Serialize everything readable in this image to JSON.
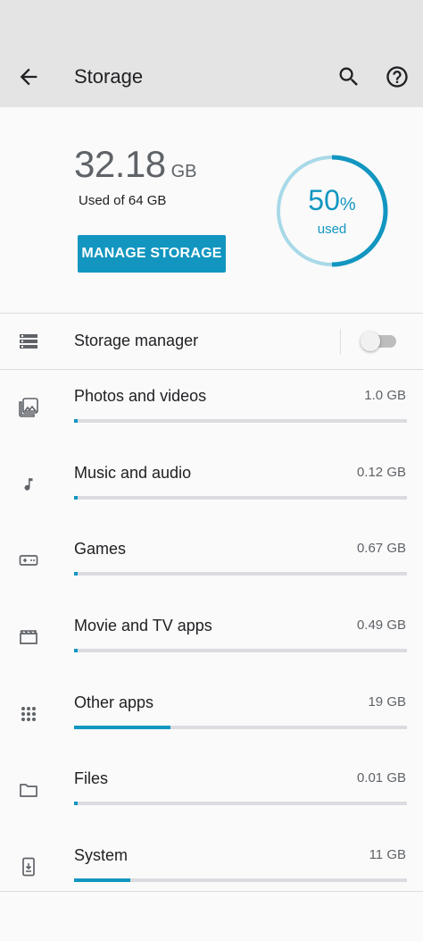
{
  "app_bar": {
    "title": "Storage",
    "back_icon": "arrow-back-icon",
    "search_icon": "search-icon",
    "help_icon": "help-icon"
  },
  "summary": {
    "used_number": "32.18",
    "used_unit": "GB",
    "used_of": "Used of 64 GB",
    "manage_button": "MANAGE STORAGE",
    "percent": "50",
    "percent_sign": "%",
    "used_word": "used",
    "percent_fraction": 0.5
  },
  "storage_manager": {
    "label": "Storage manager",
    "icon": "storage-icon",
    "enabled": false
  },
  "colors": {
    "accent": "#1296c0",
    "ring_track": "#a8d9e8",
    "bar_track": "#dadce0",
    "app_bar_bg": "#e4e4e4"
  },
  "categories": [
    {
      "name": "Photos and videos",
      "size": "1.0 GB",
      "icon": "photo-library-icon",
      "fraction": 0.01
    },
    {
      "name": "Music and audio",
      "size": "0.12 GB",
      "icon": "music-note-icon",
      "fraction": 0.0
    },
    {
      "name": "Games",
      "size": "0.67 GB",
      "icon": "gamepad-icon",
      "fraction": 0.01
    },
    {
      "name": "Movie and TV apps",
      "size": "0.49 GB",
      "icon": "movie-icon",
      "fraction": 0.0
    },
    {
      "name": "Other apps",
      "size": "19 GB",
      "icon": "apps-grid-icon",
      "fraction": 0.29
    },
    {
      "name": "Files",
      "size": "0.01 GB",
      "icon": "folder-icon",
      "fraction": 0.0
    },
    {
      "name": "System",
      "size": "11 GB",
      "icon": "system-phone-icon",
      "fraction": 0.17
    }
  ]
}
